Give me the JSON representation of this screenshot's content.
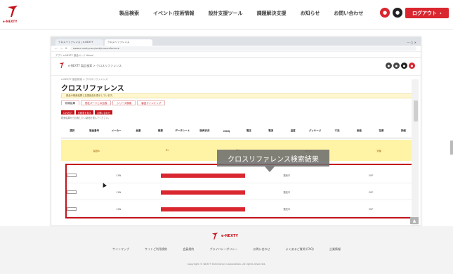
{
  "site": {
    "logo_text": "e-NEXTY",
    "nav": [
      "製品検索",
      "イベント/技術情報",
      "設計支援ツール",
      "課題解決支援",
      "お知らせ",
      "お問い合わせ"
    ],
    "logout_label": "ログアウト"
  },
  "browser": {
    "tabs": [
      "クロスリファレンス | e-NEXTY",
      "クロスリファレンス"
    ],
    "address": "www.e-nexty.com/web/crossreference",
    "bookmarks": "アプリ  e-NEXTY  製品ページ  Yahoo!"
  },
  "page": {
    "breadcrumb": "e-NEXTY 製品検索  >  クロスリファレンス",
    "title": "クロスリファレンス",
    "notice": "部品の検索結果と互換部品を表示しています。",
    "subtabs": [
      "検索結果",
      "他社パーツとの比較",
      "シリーズ検索",
      "製品ラインナップ"
    ],
    "buttons": [
      "CSV出力",
      "比較表を見る",
      "お問い合わせ"
    ],
    "hint": "検索結果から比較したい製品を選んでください。",
    "columns": [
      "選択",
      "製品番号",
      "メーカー",
      "品番",
      "概要",
      "データシート",
      "販売状況",
      "MOQ",
      "電圧",
      "電流",
      "温度",
      "パッケージ",
      "寸法",
      "価格",
      "在庫",
      "詳細"
    ],
    "yellow_values": [
      "製品A",
      "R1",
      "5V",
      "販売中",
      "対象"
    ],
    "rows": [
      {
        "part": "CXN",
        "status": "販売中",
        "pkg": "SOP"
      },
      {
        "part": "CXN",
        "status": "販売中",
        "pkg": "SOP"
      },
      {
        "part": "CXN",
        "status": "販売中",
        "pkg": "SOP"
      }
    ],
    "callout": "クロスリファレンス検索結果"
  },
  "footer": {
    "logo_text": "e-NEXTY",
    "links": [
      "サイトマップ",
      "サイトご利用規約",
      "会員規約",
      "プライバシーポリシー",
      "お問い合わせ",
      "よくあるご質問 (FAQ)",
      "企業情報"
    ],
    "copyright": "Copyright © NEXTY Electronics Corporation. All rights reserved."
  },
  "colors": {
    "accent": "#c4121a",
    "notice_bg": "#fff7cf",
    "highlight_row": "#fff3a6"
  }
}
